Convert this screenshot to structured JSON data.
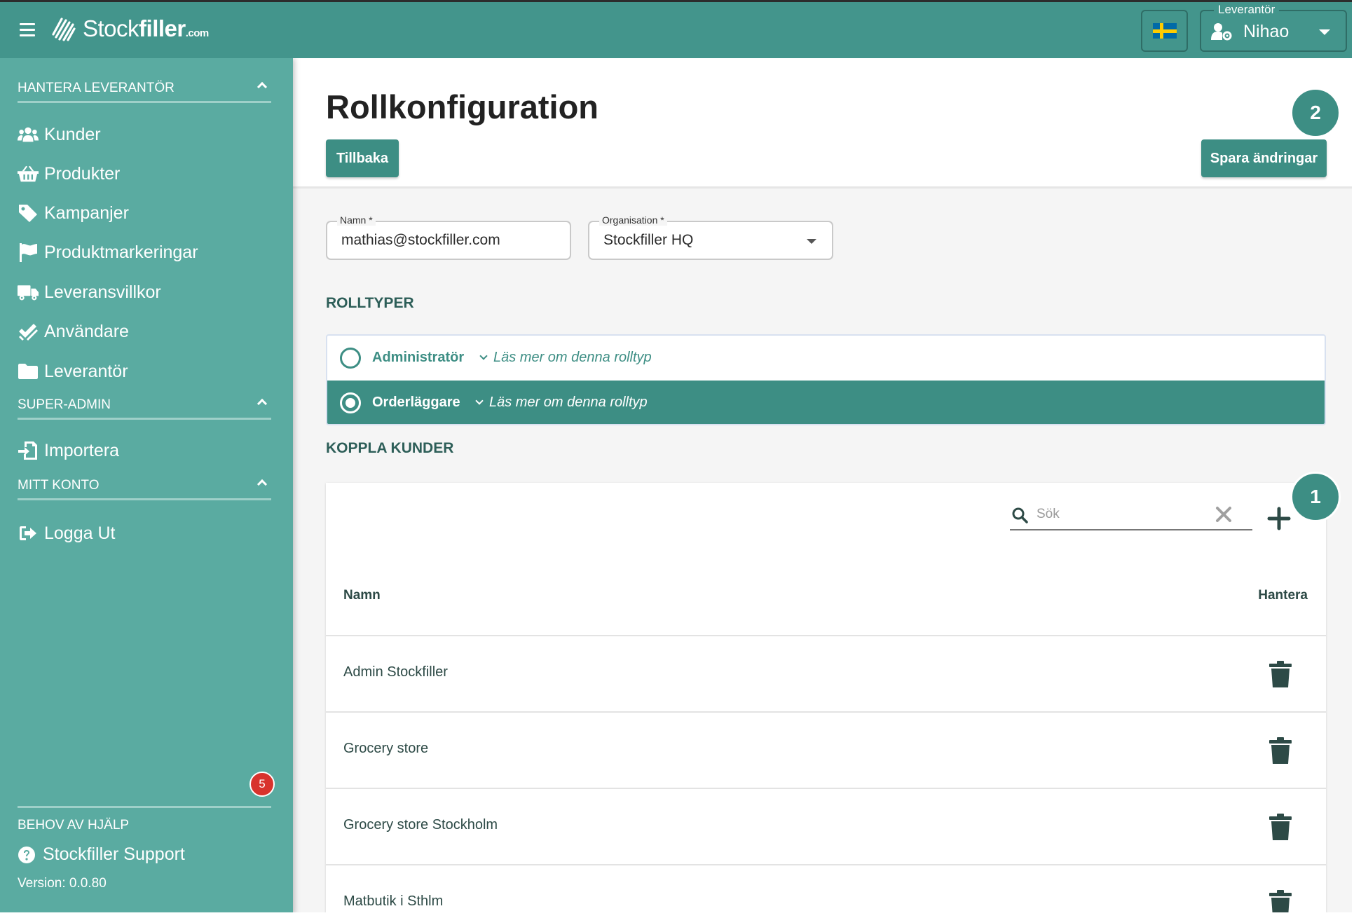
{
  "header": {
    "brand_thin": "Stock",
    "brand_bold": "filler",
    "brand_suffix": ".com",
    "supplier_label": "Leverantör",
    "supplier_value": "Nihao",
    "flag": "sweden-flag"
  },
  "sidebar": {
    "sections": [
      {
        "label": "HANTERA LEVERANTÖR"
      },
      {
        "label": "SUPER-ADMIN"
      },
      {
        "label": "MITT KONTO"
      }
    ],
    "items": [
      {
        "label": "Kunder",
        "icon": "users-icon"
      },
      {
        "label": "Produkter",
        "icon": "basket-icon"
      },
      {
        "label": "Kampanjer",
        "icon": "tag-icon"
      },
      {
        "label": "Produktmarkeringar",
        "icon": "flag-icon"
      },
      {
        "label": "Leveransvillkor",
        "icon": "truck-icon"
      },
      {
        "label": "Användare",
        "icon": "check-double-icon"
      },
      {
        "label": "Leverantör",
        "icon": "folder-icon"
      },
      {
        "label": "Importera",
        "icon": "import-icon"
      },
      {
        "label": "Logga Ut",
        "icon": "logout-icon"
      }
    ],
    "help_title": "BEHOV AV HJÄLP",
    "support_label": "Stockfiller Support",
    "version": "Version: 0.0.80",
    "chat_badge": "5"
  },
  "main": {
    "title": "Rollkonfiguration",
    "back_label": "Tillbaka",
    "save_label": "Spara ändringar",
    "step_markers": [
      "2",
      "1"
    ],
    "name_field": {
      "label": "Namn *",
      "value": "mathias@stockfiller.com"
    },
    "org_field": {
      "label": "Organisation *",
      "value": "Stockfiller HQ"
    },
    "roletypes_title": "ROLLTYPER",
    "roles": [
      {
        "name": "Administratör",
        "more": "Läs mer om denna rolltyp",
        "selected": false
      },
      {
        "name": "Orderläggare",
        "more": "Läs mer om denna rolltyp",
        "selected": true
      }
    ],
    "customers_title": "KOPPLA KUNDER",
    "search_placeholder": "Sök",
    "columns": {
      "name": "Namn",
      "manage": "Hantera"
    },
    "customers": [
      "Admin Stockfiller",
      "Grocery store",
      "Grocery store Stockholm",
      "Matbutik i Sthlm"
    ]
  },
  "colors": {
    "header": "#43958c",
    "sidebar": "#5aaba1",
    "accent": "#3d8e84",
    "badge": "#d8332d",
    "chat": "#4a85c8"
  }
}
